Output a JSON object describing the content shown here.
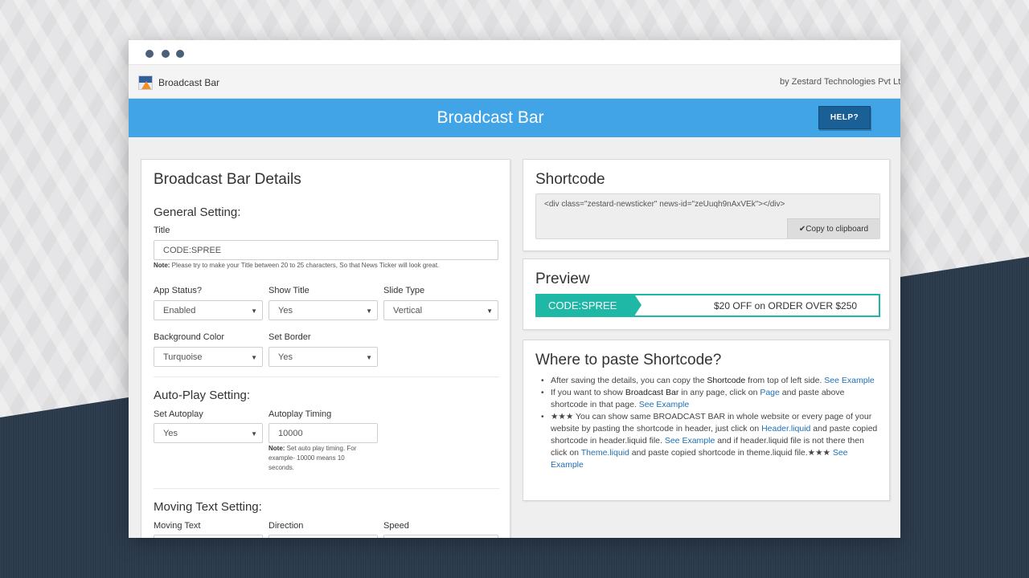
{
  "app": {
    "name": "Broadcast Bar",
    "byline": "by Zestard Technologies Pvt Ltd",
    "banner_title": "Broadcast Bar",
    "help_label": "HELP?"
  },
  "details": {
    "title": "Broadcast Bar Details",
    "general": {
      "heading": "General Setting:",
      "title_label": "Title",
      "title_value": "CODE:SPREE",
      "title_note_bold": "Note:",
      "title_note": " Please try to make your Title between 20 to 25 characters, So that News Ticker will look great.",
      "app_status_label": "App Status?",
      "app_status_value": "Enabled",
      "show_title_label": "Show Title",
      "show_title_value": "Yes",
      "slide_type_label": "Slide Type",
      "slide_type_value": "Vertical",
      "bg_color_label": "Background Color",
      "bg_color_value": "Turquoise",
      "set_border_label": "Set Border",
      "set_border_value": "Yes"
    },
    "autoplay": {
      "heading": "Auto-Play Setting:",
      "set_autoplay_label": "Set Autoplay",
      "set_autoplay_value": "Yes",
      "timing_label": "Autoplay Timing",
      "timing_value": "10000",
      "note_bold": "Note:",
      "note_line1": " Set auto play timing. For",
      "note_line2": "example- 10000 means 10",
      "note_line3": "seconds."
    },
    "moving": {
      "heading": "Moving Text Setting:",
      "moving_text_label": "Moving Text",
      "direction_label": "Direction",
      "speed_label": "Speed"
    }
  },
  "shortcode": {
    "title": "Shortcode",
    "code": "<div class=\"zestard-newsticker\" news-id=\"zeUuqh9nAxVEk\"></div>",
    "copy_label": "Copy to clipboard",
    "copy_icon": "check-icon"
  },
  "preview": {
    "title": "Preview",
    "ticker_label": "CODE:SPREE",
    "ticker_message": "$20 OFF on ORDER OVER $250",
    "accent": "#1fb7a6"
  },
  "where": {
    "title": "Where to paste Shortcode?",
    "b1_a": "After saving the details, you can copy the ",
    "b1_bold": "Shortcode",
    "b1_b": " from top of left side. ",
    "b1_link": "See Example",
    "b2_a": "If you want to show ",
    "b2_bold": "Broadcast Bar",
    "b2_b": " in any page, click on ",
    "b2_link1": "Page",
    "b2_c": " and paste above shortcode in that page. ",
    "b2_link2": "See Example",
    "b3_a": "★★★ You can show same BROADCAST BAR in whole website or every page of your website by pasting the shortcode in header, just click on ",
    "b3_link1": "Header.liquid",
    "b3_b": " and paste copied shortcode in header.liquid file. ",
    "b3_link2": "See Example",
    "b3_c": " and if header.liquid file is not there then click on ",
    "b3_link3": "Theme.liquid",
    "b3_d": " and paste copied shortcode in theme.liquid file.★★★ ",
    "b3_link4": "See Example"
  },
  "colors": {
    "banner": "#41a4e6",
    "help_button": "#1a5f95",
    "link": "#1f6fb3"
  }
}
